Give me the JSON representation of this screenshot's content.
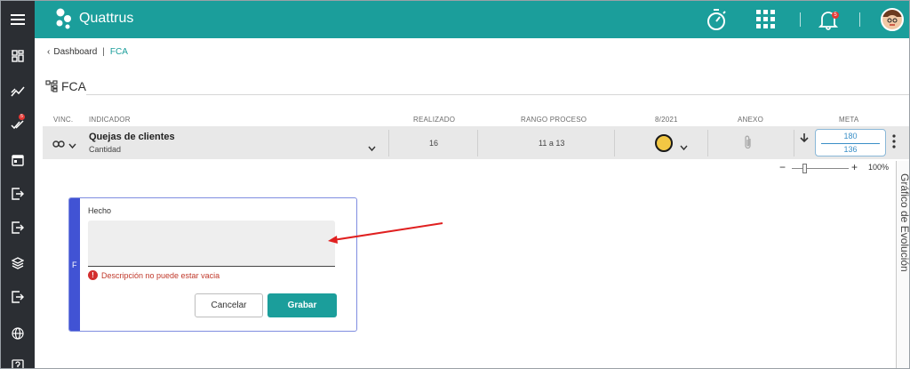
{
  "app": {
    "brand_name": "Quattrus",
    "notification_count": "5",
    "sidebar_badge_count": "5"
  },
  "breadcrumb": {
    "back_label": "Dashboard",
    "current": "FCA"
  },
  "page": {
    "title": "FCA"
  },
  "table": {
    "headers": {
      "vinc": "VINC.",
      "indicador": "INDICADOR",
      "realizado": "REALIZADO",
      "rango": "RANGO PROCESO",
      "period": "8/2021",
      "anexo": "ANEXO",
      "meta": "META"
    },
    "row": {
      "indicator_name": "Quejas de clientes",
      "indicator_unit": "Cantidad",
      "realizado": "16",
      "rango": "11 a 13",
      "status_color": "#f2c744",
      "meta_top": "180",
      "meta_bottom": "136"
    }
  },
  "zoom": {
    "minus": "−",
    "plus": "+",
    "value": "100%"
  },
  "side_panel": {
    "label": "Gráfico de Evolución"
  },
  "form": {
    "strip_letter": "F",
    "label": "Hecho",
    "value": "",
    "error": "Descripción no puede estar vacia",
    "cancel_label": "Cancelar",
    "save_label": "Grabar"
  },
  "colors": {
    "accent": "#1b9e9b",
    "sidebar": "#2b2e33",
    "form_strip": "#4153d4",
    "error": "#c0392b",
    "annotation_arrow": "#e02020"
  }
}
